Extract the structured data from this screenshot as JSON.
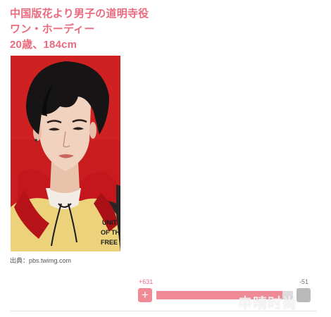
{
  "article": {
    "title_lines": [
      "中国版花より男子の道明寺役",
      "ワン・ホーディー",
      "20歳、184cm"
    ],
    "source": "出典：pbs.twimg.com",
    "photo_sweater_text": [
      "UNIT",
      "OF TH",
      "FREE"
    ]
  },
  "vote": {
    "plus_count": "+631",
    "minus_count": "-51",
    "plus_symbol": "+",
    "ratio": 0.925
  },
  "watermark": "申晴时尚",
  "colors": {
    "accent": "#ea6b7e",
    "plus_button": "#f08a97",
    "minus_button": "#b9b9b9",
    "photo_background": "#c91c1f"
  }
}
